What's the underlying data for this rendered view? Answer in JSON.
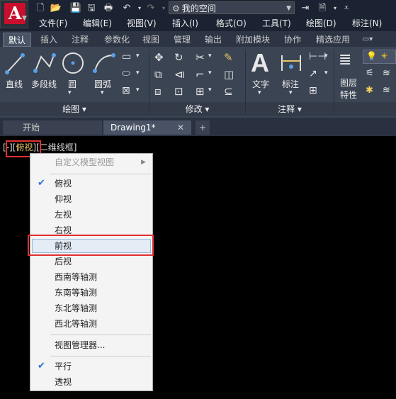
{
  "quick_access": {
    "workspace": "我的空间"
  },
  "menubar": [
    "文件(F)",
    "编辑(E)",
    "视图(V)",
    "插入(I)",
    "格式(O)",
    "工具(T)",
    "绘图(D)",
    "标注(N)"
  ],
  "ribbon_tabs": [
    "默认",
    "插入",
    "注释",
    "参数化",
    "视图",
    "管理",
    "输出",
    "附加模块",
    "协作",
    "精选应用"
  ],
  "ribbon": {
    "draw": {
      "tools": [
        "直线",
        "多段线",
        "圆",
        "圆弧"
      ],
      "panel": "绘图"
    },
    "modify": {
      "panel": "修改"
    },
    "annotate": {
      "tools": [
        "文字",
        "标注"
      ],
      "panel": "注释"
    },
    "layers": {
      "tool_line1": "图层",
      "tool_line2": "特性"
    }
  },
  "file_tabs": [
    "开始",
    "Drawing1*"
  ],
  "viewport_label": {
    "prefix": "[-][",
    "current_view": "俯视",
    "middle": "][",
    "visual_style": "二维线框",
    "suffix": "]"
  },
  "context_menu": {
    "header": "自定义模型视图",
    "views": [
      "俯视",
      "仰视",
      "左视",
      "右视",
      "前视",
      "后视",
      "西南等轴测",
      "东南等轴测",
      "东北等轴测",
      "西北等轴测"
    ],
    "manager": "视图管理器...",
    "projections": [
      "平行",
      "透视"
    ],
    "checked_view": "俯视",
    "checked_projection": "平行",
    "highlighted": "前视"
  },
  "colors": {
    "accent_red": "#e03030",
    "check_blue": "#2a6fd6",
    "current_view": "#e8c46a"
  }
}
